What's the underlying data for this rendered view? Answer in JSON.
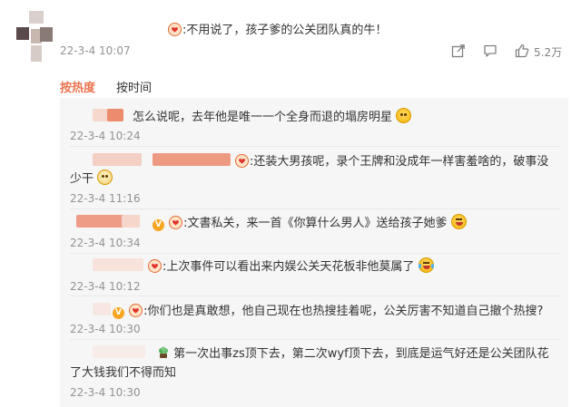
{
  "main_comment": {
    "text": ":不用说了，孩子爹的公关团队真的牛！",
    "time": "22-3-4 10:07",
    "likes": "5.2万",
    "icons": [
      "share-icon",
      "comment-icon",
      "like-icon"
    ]
  },
  "sort_tabs": {
    "hot": "按热度",
    "time": "按时间"
  },
  "replies": [
    {
      "text": "怎么说呢，去年他是唯一一个全身而退的塌房明星",
      "time": "22-3-4 10:24",
      "emoji": "smirk"
    },
    {
      "text_line1": ":还装大男孩呢，录个王牌和没成年一样害羞啥的，破事没",
      "text_line2": "少干",
      "time": "22-3-4 11:16",
      "emoji": "shrug"
    },
    {
      "text": ":文書私关，来一首《你算什么男人》送给孩子她爹",
      "time": "22-3-4 10:34",
      "emoji": "laugh"
    },
    {
      "text": ":上次事件可以看出来内娱公关天花板非他莫属了",
      "time": "22-3-4 10:12",
      "emoji": "tears-of-joy"
    },
    {
      "text": ":你们也是真敢想，他自己现在也热搜挂着呢，公关厉害不知道自己撤个热搜?",
      "time": "22-3-4 10:30"
    },
    {
      "text_line1": "第一次出事zs顶下去，第二次wyf顶下去，到底是运气好还是公关团队花",
      "text_line2": "了大钱我们不得而知",
      "time": "22-3-4 10:30"
    }
  ],
  "colors": {
    "accent": "#eb7350",
    "meta_text": "#939393",
    "panel_bg": "#f6f6f6"
  }
}
